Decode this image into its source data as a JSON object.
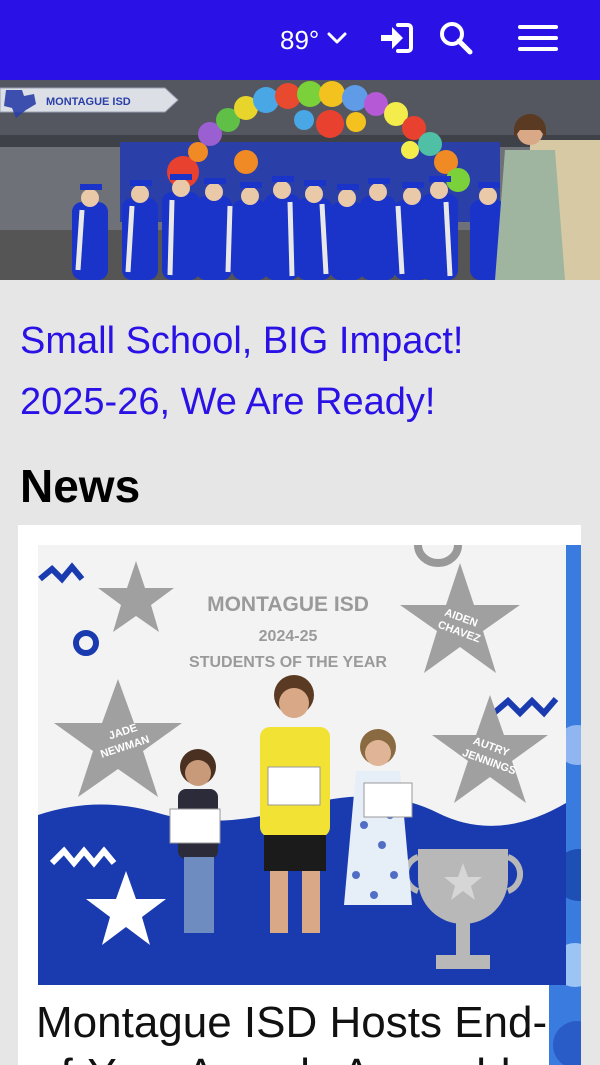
{
  "header": {
    "weather_temp": "89°",
    "icons": [
      "chevron-down-icon",
      "sign-in-icon",
      "search-icon",
      "hamburger-menu-icon"
    ],
    "background_color": "#2a12e6"
  },
  "hero": {
    "logo_text": "MONTAGUE ISD"
  },
  "tagline": {
    "line1": "Small School, BIG Impact!",
    "line2": "2025-26, We Are Ready!",
    "color": "#2a12e6"
  },
  "news": {
    "heading": "News",
    "articles": [
      {
        "image_text": {
          "org": "MONTAGUE ISD",
          "year": "2024-25",
          "subtitle": "STUDENTS OF THE YEAR",
          "star_names": [
            [
              "AIDEN",
              "CHAVEZ"
            ],
            [
              "JADE",
              "NEWMAN"
            ],
            [
              "AUTRY",
              "JENNINGS"
            ]
          ]
        },
        "title_line1": "Montague ISD Hosts End-",
        "title_line2": "of-Year Awards Assembly"
      }
    ]
  }
}
